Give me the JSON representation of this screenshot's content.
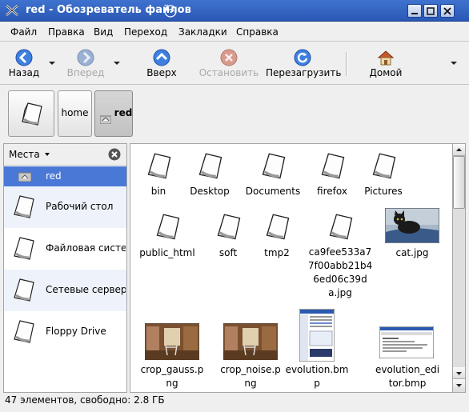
{
  "window": {
    "title": "red - Обозреватель файлов"
  },
  "menu": [
    "Файл",
    "Правка",
    "Вид",
    "Переход",
    "Закладки",
    "Справка"
  ],
  "toolbar": {
    "back": "Назад",
    "forward": "Вперед",
    "up": "Вверх",
    "stop": "Остановить",
    "reload": "Перезагрузить",
    "home": "Домой"
  },
  "path": {
    "home": "home",
    "current": "red"
  },
  "sidebar": {
    "header": "Места",
    "items": [
      {
        "label": "red",
        "icon": "home-folder-icon"
      },
      {
        "label": "Рабочий стол",
        "icon": "document-icon"
      },
      {
        "label": "Файловая система",
        "icon": "document-icon"
      },
      {
        "label": "Сетевые серверы",
        "icon": "document-icon"
      },
      {
        "label": "Floppy Drive",
        "icon": "document-icon"
      }
    ]
  },
  "files": [
    {
      "name": "bin",
      "kind": "doc"
    },
    {
      "name": "Desktop",
      "kind": "doc"
    },
    {
      "name": "Documents",
      "kind": "doc"
    },
    {
      "name": "firefox",
      "kind": "doc"
    },
    {
      "name": "Pictures",
      "kind": "doc"
    },
    {
      "name": "public_html",
      "kind": "doc"
    },
    {
      "name": "soft",
      "kind": "doc"
    },
    {
      "name": "tmp2",
      "kind": "doc"
    },
    {
      "name": "ca9fee533a77f00abb21b46ed06c39da.jpg",
      "display": [
        "ca9fee533a7",
        "7f00abb21b4",
        "6ed06c39d",
        "a.jpg"
      ],
      "kind": "doc"
    },
    {
      "name": "cat.jpg",
      "kind": "photo-cat"
    },
    {
      "name": "crop_gauss.png",
      "display": [
        "crop_gauss.p",
        "ng"
      ],
      "kind": "photo-room"
    },
    {
      "name": "crop_noise.png",
      "display": [
        "crop_noise.p",
        "ng"
      ],
      "kind": "photo-room"
    },
    {
      "name": "evolution.bmp",
      "display": [
        "evolution.bm",
        "p"
      ],
      "kind": "screenshot-tall"
    },
    {
      "name": "evolution_editor.bmp",
      "display": [
        "evolution_edi",
        "tor.bmp"
      ],
      "kind": "screenshot-wide"
    }
  ],
  "status": "47 элементов, свободно: 2.8 ГБ",
  "colors": {
    "titlebar": "#3466c8",
    "selection": "#4a78d6"
  }
}
